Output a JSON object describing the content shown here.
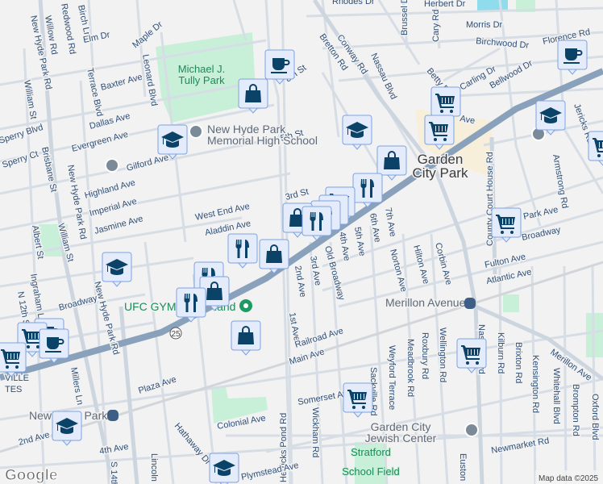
{
  "streets": {
    "new_hyde_park_rd": "New Hyde Park Rd",
    "willow_rd": "Willow Rd",
    "redwood_rd": "Redwood Rd",
    "birch_ln": "Birch Ln",
    "elm_dr": "Elm Dr",
    "maple_dr": "Maple Dr",
    "leonard_blvd": "Leonard Blvd",
    "terrace_blvd": "Terrace Blvd",
    "baxter_ave": "Baxter Ave",
    "dallas_ave": "Dallas Ave",
    "evergreen_ave": "Evergreen Ave",
    "gilford_ave": "Gilford Ave",
    "highland_ave": "Highland Ave",
    "imperial_ave": "Imperial Ave",
    "jasmine_ave": "Jasmine Ave",
    "west_end_ave": "West End Ave",
    "aladdin_ave": "Aladdin Ave",
    "william_st": "William St",
    "brisbane_st": "Brisbane St",
    "sperry_ct": "Sperry Ct",
    "sperry_blvd": "Sperry Blvd",
    "albert_st": "Albert St",
    "eighth_st": "8th St",
    "fifth_st": "5th St",
    "third_st": "3rd St",
    "bretton_rd": "Bretton Rd",
    "conway_rd": "Conway Rd",
    "nassau_blvd": "Nassau Blvd",
    "brussel_dr": "Brussel Dr",
    "cary_rd": "Cary Rd",
    "herbert_dr": "Herbert Dr",
    "rhodes_dr": "Rhodes Dr",
    "morris_dr": "Morris Dr",
    "birchwood_dr": "Birchwood Dr",
    "florence_rd": "Florence Rd",
    "bellwood_dr": "Bellwood Dr",
    "betty_rd": "Betty Rd",
    "carling_dr": "Carling Dr",
    "willis_ave": "Ave",
    "county_court_house_rd": "County Court House Rd",
    "armstrong_rd": "Armstrong Rd",
    "jericks_rd": "Jericks Rd",
    "park_ave": "Park Ave",
    "broadway_e": "Broadway",
    "fulton_ave": "Fulton Ave",
    "atlantic_ave": "Atlantic Ave",
    "seventh_ave": "7th Ave",
    "sixth_ave": "6th Ave",
    "fifth_ave": "5th Ave",
    "fourth_ave": "4th Ave",
    "third_ave": "3rd Ave",
    "second_ave": "2nd Ave",
    "first_ave": "1st Ave",
    "old_broadway": "Old Broadway",
    "norton_ave": "Norton Ave",
    "hilton_ave": "Hilton Ave",
    "corbin_ave": "Corbin Ave",
    "railroad_ave": "Railroad Ave",
    "main_ave": "Main Ave",
    "weyford_terrace": "Weyford Terrace",
    "meadbrook_rd": "Meadbrook Rd",
    "roxbury_rd": "Roxbury Rd",
    "wellington_rd": "Wellington Rd",
    "kilburn_rd": "Kilburn Rd",
    "brixton_rd": "Brixton Rd",
    "kensington_rd": "Kensington Rd",
    "whitehall_blvd": "Whitehall Blvd",
    "brompton_rd": "Brompton Rd",
    "oxford_blvd": "Oxford Blvd",
    "merillon_ave": "Merillon Ave",
    "somerset_ave": "Somerset Ave",
    "wickham_rd": "Wickham Rd",
    "euston_rd": "Euston Rd",
    "newmarket_rd": "Newmarket Rd",
    "sackville_rd": "Sackville Rd",
    "broadway_w": "Broadway",
    "ingraham_ln": "Ingraham Ln",
    "n12th_st": "N 12th St",
    "millers_ln": "Millers Ln",
    "plaza_ave": "Plaza Ave",
    "colonial_ave": "Colonial Ave",
    "second_ave_w": "2nd Ave",
    "fourth_ave_w": "4th Ave",
    "s14th_st": "S 14th St",
    "lincoln_st": "Lincoln St",
    "hathaway_dr": "Hathaway Dr",
    "herricks_pond_rd": "Herricks Pond Rd",
    "plymstead_ave": "Plymstead Ave",
    "route_25": "25"
  },
  "places": {
    "garden_city_park": [
      "Garden",
      "City Park"
    ],
    "villa_estates": [
      "VILLE",
      "TES"
    ]
  },
  "pois": {
    "tully_park": [
      "Michael J.",
      "Tully Park"
    ],
    "nhp_high_school": [
      "New Hyde Park",
      "Memorial High School"
    ],
    "ufc_gym": "UFC GYM",
    "ufc_gym_suffix": "land",
    "merillon_station": "Merillon Avenue",
    "new_hyde_park_station": "New Hyde Park",
    "gc_jewish_center": [
      "Garden City",
      "Jewish Center"
    ],
    "stratford_field": [
      "Stratford",
      "School Field"
    ]
  },
  "attribution": {
    "logo": "Google",
    "map_data": "Map data ©2025"
  },
  "markers": [
    {
      "type": "coffee"
    },
    {
      "type": "shopping-bag"
    },
    {
      "type": "school"
    },
    {
      "type": "school"
    },
    {
      "type": "grocery-cart"
    },
    {
      "type": "grocery-cart"
    },
    {
      "type": "shopping-bag"
    },
    {
      "type": "coffee"
    },
    {
      "type": "school"
    },
    {
      "type": "grocery-cart"
    },
    {
      "type": "restaurant"
    },
    {
      "type": "grocery-cart"
    },
    {
      "type": "restaurant"
    },
    {
      "type": "restaurant"
    },
    {
      "type": "shopping-bag"
    },
    {
      "type": "restaurant"
    },
    {
      "type": "restaurant"
    },
    {
      "type": "shopping-bag"
    },
    {
      "type": "school"
    },
    {
      "type": "restaurant"
    },
    {
      "type": "shopping-bag"
    },
    {
      "type": "restaurant"
    },
    {
      "type": "shopping-bag"
    },
    {
      "type": "grocery-cart"
    },
    {
      "type": "coffee"
    },
    {
      "type": "grocery-cart"
    },
    {
      "type": "coffee"
    },
    {
      "type": "grocery-cart"
    },
    {
      "type": "grocery-cart"
    },
    {
      "type": "grocery-cart"
    },
    {
      "type": "school"
    },
    {
      "type": "school"
    }
  ],
  "colors": {
    "marker_fill": "#e4ecfb",
    "marker_border": "#7da2e0",
    "icon": "#0b4368",
    "highway": "#8aa1bb",
    "park": "#c8f0d8"
  }
}
